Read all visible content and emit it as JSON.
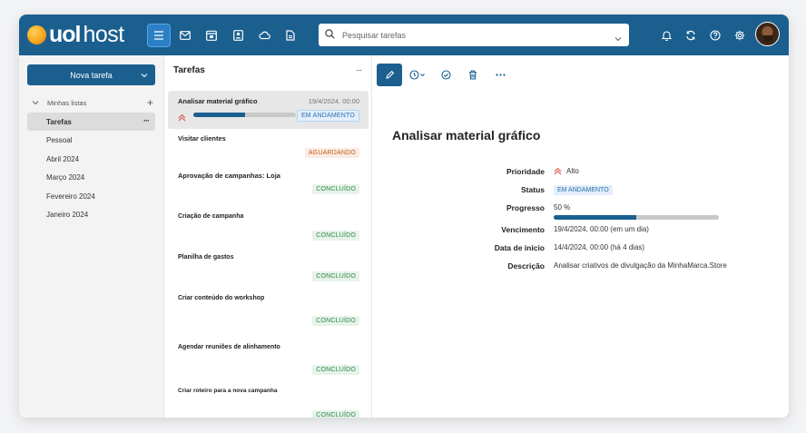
{
  "brand": {
    "logo_bold": "uol",
    "logo_light": "host"
  },
  "header": {
    "search_placeholder": "Pesquisar tarefas",
    "apps": [
      "menu-icon",
      "mail-icon",
      "calendar-icon",
      "contacts-icon",
      "cloud-icon",
      "document-icon"
    ],
    "right_icons": [
      "bell-icon",
      "sync-icon",
      "help-icon",
      "settings-icon"
    ]
  },
  "sidebar": {
    "new_task_label": "Nova tarefa",
    "lists_header": "Minhas listas",
    "lists": [
      {
        "label": "Tarefas",
        "active": true
      },
      {
        "label": "Pessoal"
      },
      {
        "label": "Abril 2024"
      },
      {
        "label": "Março 2024"
      },
      {
        "label": "Fevereiro 2024"
      },
      {
        "label": "Janeiro 2024"
      }
    ]
  },
  "tasks_panel": {
    "title": "Tarefas",
    "more": "···",
    "tasks": [
      {
        "title": "Analisar material gráfico",
        "date": "19/4/2024, 00:00",
        "status": "EM ANDAMENTO",
        "priority": "Alto",
        "progress": 0.5
      },
      {
        "title": "Visitar clientes",
        "status": "AGUARDANDO"
      },
      {
        "title": "Aprovação de campanhas: Loja",
        "status": "CONCLUÍDO"
      },
      {
        "title": "Criação de campanha",
        "status": "CONCLUÍDO"
      },
      {
        "title": "Planilha de gastos",
        "status": "CONCLUÍDO"
      },
      {
        "title": "Criar conteúdo do workshop",
        "status": "CONCLUÍDO"
      },
      {
        "title": "Agendar reuniões de alinhamento",
        "status": "CONCLUÍDO"
      },
      {
        "title": "Criar roteiro para a nova campanha",
        "status": "CONCLUÍDO"
      }
    ]
  },
  "detail": {
    "title": "Analisar material gráfico",
    "toolbar": [
      "edit-icon",
      "clock-icon",
      "check-circle-icon",
      "trash-icon",
      "more-icon"
    ],
    "labels": {
      "priority": "Prioridade",
      "status": "Status",
      "progress": "Progresso",
      "due": "Vencimento",
      "start": "Data de início",
      "description": "Descrição"
    },
    "values": {
      "priority": "Alto",
      "status": "EM ANDAMENTO",
      "progress": "50 %",
      "progress_fraction": 0.5,
      "due": "19/4/2024, 00:00 (em um dia)",
      "start": "14/4/2024, 00:00 (há 4 dias)",
      "description": "Analisar criativos de divulgação da MinhaMarca.Store"
    }
  },
  "colors": {
    "brand": "#1b5f8f",
    "priority_high": "#d9534f",
    "in_progress": "#2a6fae",
    "waiting": "#c55a20",
    "done": "#2c8a45"
  }
}
